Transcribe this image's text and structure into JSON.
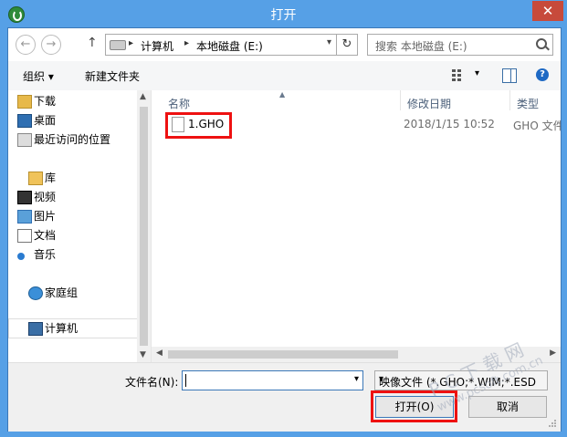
{
  "window": {
    "title": "打开"
  },
  "address": {
    "segments": [
      "计算机",
      "本地磁盘 (E:)"
    ],
    "search_placeholder": "搜索 本地磁盘 (E:)"
  },
  "toolbar": {
    "organize": "组织 ▾",
    "new_folder": "新建文件夹"
  },
  "nav": {
    "favorites": [
      "下载",
      "桌面",
      "最近访问的位置"
    ],
    "library": "库",
    "library_items": [
      "视频",
      "图片",
      "文档",
      "音乐"
    ],
    "homegroup": "家庭组",
    "computer": "计算机"
  },
  "columns": {
    "name": "名称",
    "modified": "修改日期",
    "type": "类型"
  },
  "files": [
    {
      "name": "1.GHO",
      "modified": "2018/1/15 10:52",
      "type": "GHO 文件"
    }
  ],
  "bottom": {
    "filename_label": "文件名(N):",
    "filename_value": "",
    "filetype": "映像文件 (*.GHO;*.WIM;*.ESD",
    "open_label": "打开(O)",
    "cancel_label": "取消"
  },
  "watermark": {
    "main": "P C 下 载 网",
    "url": "www.pcsoft.com.cn"
  }
}
